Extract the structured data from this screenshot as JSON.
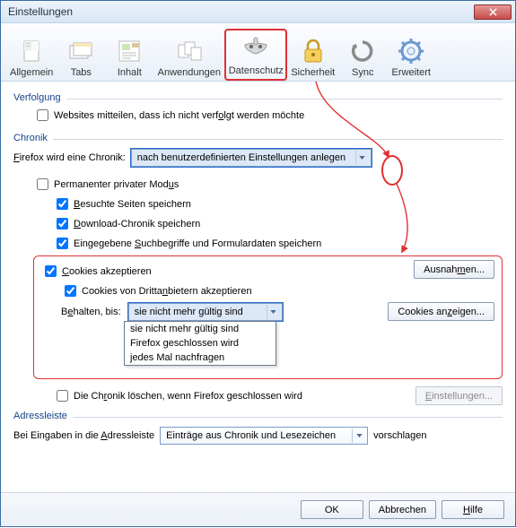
{
  "window": {
    "title": "Einstellungen"
  },
  "tabs": {
    "general": "Allgemein",
    "tabs": "Tabs",
    "content": "Inhalt",
    "apps": "Anwendungen",
    "privacy": "Datenschutz",
    "security": "Sicherheit",
    "sync": "Sync",
    "advanced": "Erweitert"
  },
  "tracking": {
    "heading": "Verfolgung",
    "dnt": {
      "pre": "Websites mitteilen, dass ich nicht verf",
      "u": "o",
      "post": "lgt werden möchte"
    }
  },
  "chronicle": {
    "heading": "Chronik",
    "line": {
      "pre": "",
      "u": "F",
      "mid": "irefox wird eine Chronik:",
      "select": "nach benutzerdefinierten Einstellungen anlegen"
    },
    "perm": {
      "pre": "Permanenter privater Mod",
      "u": "u",
      "post": "s"
    },
    "visited": {
      "u": "B",
      "post": "esuchte Seiten speichern"
    },
    "downloads": {
      "u": "D",
      "post": "ownload-Chronik speichern"
    },
    "form": {
      "pre": "Eingegebene ",
      "u": "S",
      "post": "uchbegriffe und Formulardaten speichern"
    },
    "cookies_accept": {
      "u": "C",
      "post": "ookies akzeptieren"
    },
    "thirdparty": {
      "pre": "Cookies von Dritta",
      "u": "n",
      "post": "bietern akzeptieren"
    },
    "keep": {
      "pre": "B",
      "u": "e",
      "post": "halten, bis:"
    },
    "keep_select": "sie nicht mehr gültig sind",
    "keep_options": [
      "sie nicht mehr gültig sind",
      "Firefox geschlossen wird",
      "jedes Mal nachfragen"
    ],
    "exceptions": {
      "pre": "Ausnah",
      "u": "m",
      "post": "en..."
    },
    "show_cookies": {
      "pre": "Cookies an",
      "u": "z",
      "post": "eigen..."
    },
    "clear_on_close": {
      "pre": "Die Ch",
      "u": "r",
      "post": "onik löschen, wenn Firefox geschlossen wird"
    },
    "settings": {
      "u": "E",
      "post": "instellungen..."
    }
  },
  "addressbar": {
    "heading": "Adressleiste",
    "line": {
      "pre": "Bei Eingaben in die ",
      "u": "A",
      "post": "dressleiste"
    },
    "select": "Einträge aus Chronik und Lesezeichen",
    "suffix": "vorschlagen"
  },
  "footer": {
    "ok": "OK",
    "cancel": "Abbrechen",
    "help": {
      "u": "H",
      "post": "ilfe"
    }
  }
}
